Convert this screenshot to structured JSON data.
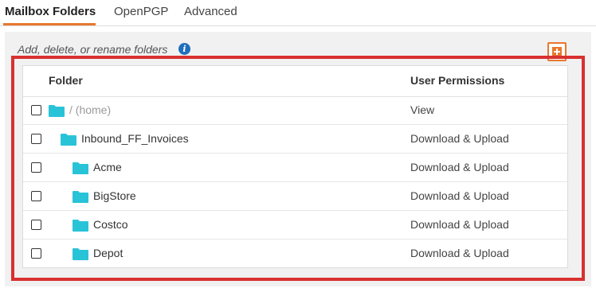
{
  "tabs": [
    {
      "label": "Mailbox Folders",
      "active": true
    },
    {
      "label": "OpenPGP",
      "active": false
    },
    {
      "label": "Advanced",
      "active": false
    }
  ],
  "panel": {
    "subtitle": "Add, delete, or rename folders",
    "info_icon": "info-icon",
    "add_button_icon": "add-folder-icon"
  },
  "table": {
    "headers": {
      "folder": "Folder",
      "permissions": "User Permissions"
    },
    "rows": [
      {
        "name": "/ (home)",
        "permission": "View",
        "depth": 0,
        "muted": true,
        "checked": false
      },
      {
        "name": "Inbound_FF_Invoices",
        "permission": "Download & Upload",
        "depth": 1,
        "muted": false,
        "checked": false
      },
      {
        "name": "Acme",
        "permission": "Download & Upload",
        "depth": 2,
        "muted": false,
        "checked": false
      },
      {
        "name": "BigStore",
        "permission": "Download & Upload",
        "depth": 2,
        "muted": false,
        "checked": false
      },
      {
        "name": "Costco",
        "permission": "Download & Upload",
        "depth": 2,
        "muted": false,
        "checked": false
      },
      {
        "name": "Depot",
        "permission": "Download & Upload",
        "depth": 2,
        "muted": false,
        "checked": false
      }
    ]
  },
  "colors": {
    "accent": "#e8772e",
    "folder": "#29c3d8",
    "highlight": "#d83131",
    "info": "#1f6fbd"
  }
}
